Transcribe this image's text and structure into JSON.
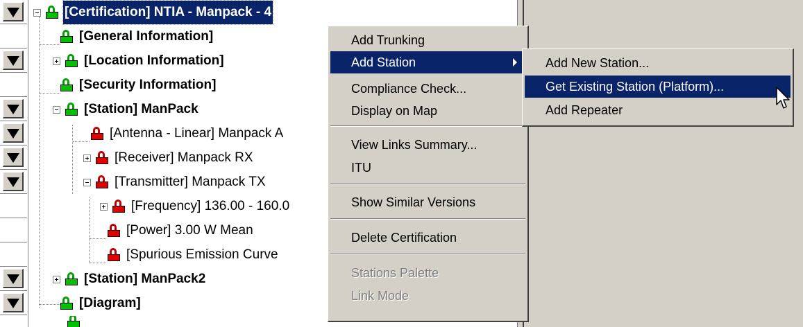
{
  "tree": {
    "nodes": [
      {
        "label": "[Certification] NTIA - Manpack - 4",
        "bold": true,
        "selected": true,
        "lock": "green",
        "expander": "minus"
      },
      {
        "label": "[General Information]",
        "bold": true,
        "lock": "green"
      },
      {
        "label": "[Location Information]",
        "bold": true,
        "lock": "green",
        "expander": "plus"
      },
      {
        "label": "[Security Information]",
        "bold": true,
        "lock": "green"
      },
      {
        "label": "[Station] ManPack",
        "bold": true,
        "lock": "green",
        "expander": "minus"
      },
      {
        "label": "[Antenna - Linear] Manpack A",
        "bold": false,
        "lock": "red"
      },
      {
        "label": "[Receiver] Manpack RX",
        "bold": false,
        "lock": "red",
        "expander": "plus"
      },
      {
        "label": "[Transmitter] Manpack TX",
        "bold": false,
        "lock": "red",
        "expander": "minus"
      },
      {
        "label": "[Frequency] 136.00 - 160.0",
        "bold": false,
        "lock": "red",
        "expander": "plus"
      },
      {
        "label": "[Power] 3.00 W Mean",
        "bold": false,
        "lock": "red"
      },
      {
        "label": "[Spurious Emission Curve",
        "bold": false,
        "lock": "red"
      },
      {
        "label": "[Station] ManPack2",
        "bold": true,
        "lock": "green",
        "expander": "plus"
      },
      {
        "label": "[Diagram]",
        "bold": true,
        "lock": "green"
      }
    ]
  },
  "context_menu": {
    "items": [
      {
        "label": "Add Trunking"
      },
      {
        "label": "Add Station",
        "highlighted": true,
        "submenu": true
      },
      {
        "label": "Compliance Check..."
      },
      {
        "label": "Display on Map"
      },
      {
        "separator": true
      },
      {
        "label": "View Links Summary..."
      },
      {
        "label": "ITU"
      },
      {
        "separator": true
      },
      {
        "label": "Show Similar Versions"
      },
      {
        "separator": true
      },
      {
        "label": "Delete Certification"
      },
      {
        "separator": true
      },
      {
        "label": "Stations Palette",
        "disabled": true
      },
      {
        "label": "Link Mode",
        "disabled": true
      }
    ]
  },
  "submenu": {
    "items": [
      {
        "label": "Add New Station..."
      },
      {
        "label": "Get Existing Station (Platform)...",
        "highlighted": true
      },
      {
        "label": "Add Repeater"
      }
    ]
  },
  "icons": {
    "lock_green": "green-lock-icon",
    "lock_red": "red-lock-icon",
    "row_arrow": "down-triangle-icon",
    "cursor": "mouse-pointer-icon"
  },
  "colors": {
    "selection": "#0a246a",
    "chrome": "#d4d0c8",
    "lock_green": "#00c000",
    "lock_red": "#e00000"
  }
}
